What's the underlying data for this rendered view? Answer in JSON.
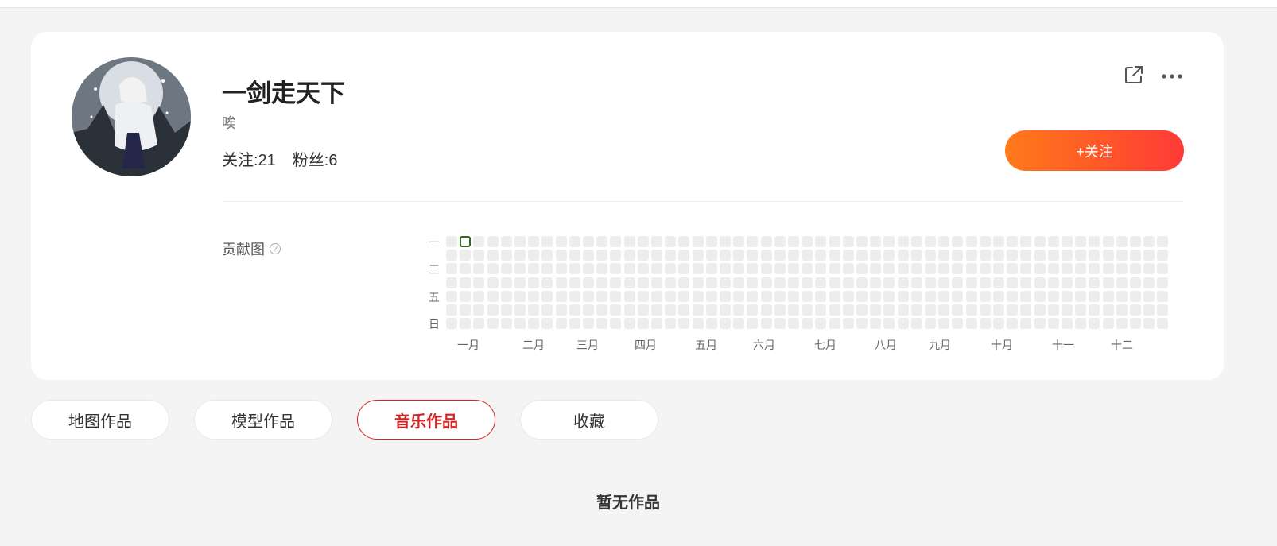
{
  "profile": {
    "username": "一剑走天下",
    "bio": "唉",
    "following": "关注:21",
    "followers": "粉丝:6",
    "follow_button": "+关注",
    "share_icon": "share-icon",
    "more_icon": "more-icon",
    "avatar_icon": "avatar"
  },
  "contribution": {
    "label": "贡献图",
    "help_icon": "help-icon",
    "help_glyph": "?",
    "day_labels": [
      "一",
      "三",
      "五",
      "日"
    ],
    "month_labels": [
      "一月",
      "二月",
      "三月",
      "四月",
      "五月",
      "六月",
      "七月",
      "八月",
      "九月",
      "十月",
      "十一",
      "十二"
    ],
    "active_cells": [
      {
        "week": 1,
        "day": 0
      }
    ],
    "colors": {
      "empty": "#ededed",
      "active_border": "#2f6b1f"
    }
  },
  "tabs": [
    {
      "label": "地图作品",
      "active": false
    },
    {
      "label": "模型作品",
      "active": false
    },
    {
      "label": "音乐作品",
      "active": true
    },
    {
      "label": "收藏",
      "active": false
    }
  ],
  "content": {
    "empty_text": "暂无作品"
  },
  "colors": {
    "accent": "#d42525",
    "follow_gradient_start": "#ff7a1a",
    "follow_gradient_end": "#ff3a36",
    "page_bg": "#f4f4f4"
  }
}
